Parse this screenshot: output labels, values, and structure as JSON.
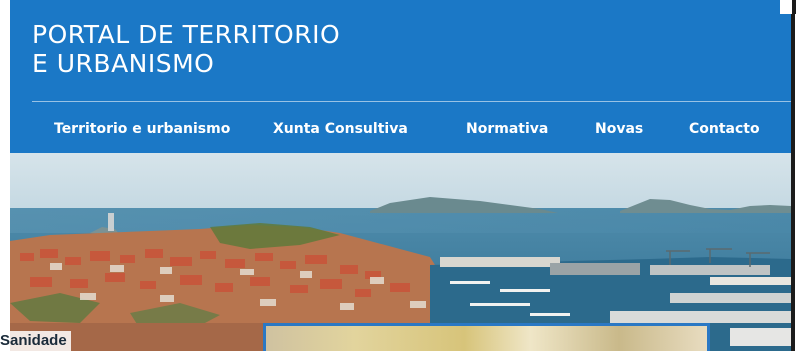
{
  "header": {
    "title_line1": "PORTAL DE TERRITORIO",
    "title_line2": "E URBANISMO",
    "background": "#1b78c6"
  },
  "nav": {
    "items": [
      {
        "label": "Territorio e urbanismo"
      },
      {
        "label": "Xunta Consultiva"
      },
      {
        "label": "Normativa"
      },
      {
        "label": "Novas"
      },
      {
        "label": "Contacto"
      }
    ]
  },
  "hero": {
    "image_semantic": "coastal-city-port-photo"
  },
  "section": {
    "label": "Sanidade"
  },
  "colors": {
    "accent": "#1b78c6",
    "card_border": "#2a78c4"
  }
}
